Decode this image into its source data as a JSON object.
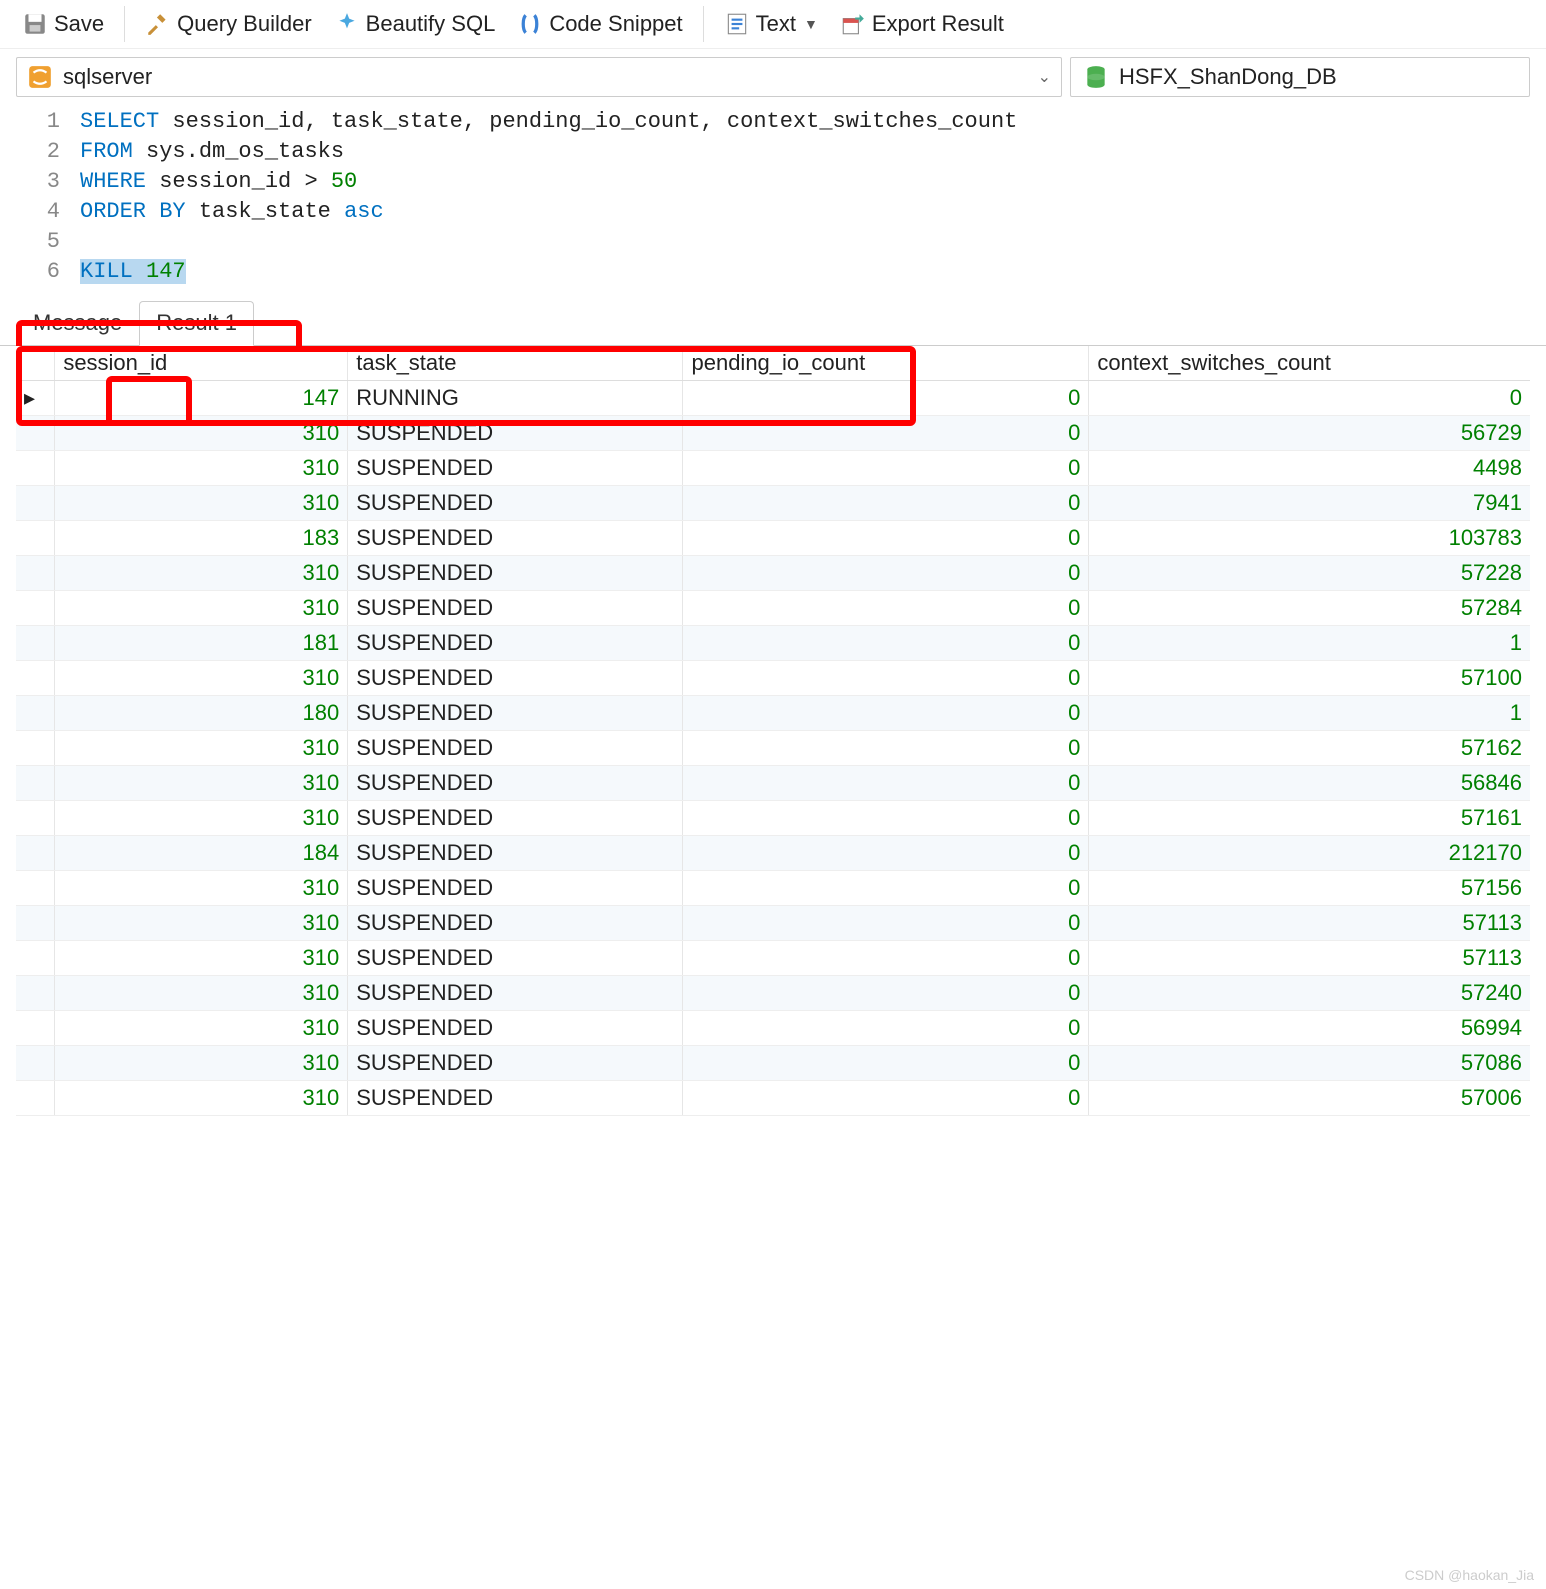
{
  "toolbar": {
    "save": "Save",
    "query_builder": "Query Builder",
    "beautify": "Beautify SQL",
    "code_snippet": "Code Snippet",
    "text": "Text",
    "export_result": "Export Result"
  },
  "connection": {
    "name": "sqlserver",
    "database": "HSFX_ShanDong_DB"
  },
  "editor": {
    "lines": [
      {
        "n": "1",
        "tokens": [
          [
            "kw",
            "SELECT"
          ],
          [
            "",
            " session_id, task_state, pending_io_count, context_switches_count"
          ]
        ]
      },
      {
        "n": "2",
        "tokens": [
          [
            "kw",
            "FROM"
          ],
          [
            "",
            " sys.dm_os_tasks"
          ]
        ]
      },
      {
        "n": "3",
        "tokens": [
          [
            "kw",
            "WHERE"
          ],
          [
            "",
            " session_id > "
          ],
          [
            "num",
            "50"
          ]
        ]
      },
      {
        "n": "4",
        "tokens": [
          [
            "kw",
            "ORDER BY"
          ],
          [
            "",
            " task_state "
          ],
          [
            "kw",
            "asc"
          ]
        ]
      },
      {
        "n": "5",
        "tokens": []
      },
      {
        "n": "6",
        "tokens": [
          [
            "kw sel",
            "KILL"
          ],
          [
            "sel",
            " "
          ],
          [
            "num sel",
            "147"
          ]
        ]
      }
    ]
  },
  "tabs": {
    "message": "Message",
    "result1": "Result 1"
  },
  "grid": {
    "columns": [
      "session_id",
      "task_state",
      "pending_io_count",
      "context_switches_count"
    ],
    "rows": [
      {
        "session_id": "147",
        "task_state": "RUNNING",
        "pending_io_count": "0",
        "context_switches_count": "0"
      },
      {
        "session_id": "310",
        "task_state": "SUSPENDED",
        "pending_io_count": "0",
        "context_switches_count": "56729"
      },
      {
        "session_id": "310",
        "task_state": "SUSPENDED",
        "pending_io_count": "0",
        "context_switches_count": "4498"
      },
      {
        "session_id": "310",
        "task_state": "SUSPENDED",
        "pending_io_count": "0",
        "context_switches_count": "7941"
      },
      {
        "session_id": "183",
        "task_state": "SUSPENDED",
        "pending_io_count": "0",
        "context_switches_count": "103783"
      },
      {
        "session_id": "310",
        "task_state": "SUSPENDED",
        "pending_io_count": "0",
        "context_switches_count": "57228"
      },
      {
        "session_id": "310",
        "task_state": "SUSPENDED",
        "pending_io_count": "0",
        "context_switches_count": "57284"
      },
      {
        "session_id": "181",
        "task_state": "SUSPENDED",
        "pending_io_count": "0",
        "context_switches_count": "1"
      },
      {
        "session_id": "310",
        "task_state": "SUSPENDED",
        "pending_io_count": "0",
        "context_switches_count": "57100"
      },
      {
        "session_id": "180",
        "task_state": "SUSPENDED",
        "pending_io_count": "0",
        "context_switches_count": "1"
      },
      {
        "session_id": "310",
        "task_state": "SUSPENDED",
        "pending_io_count": "0",
        "context_switches_count": "57162"
      },
      {
        "session_id": "310",
        "task_state": "SUSPENDED",
        "pending_io_count": "0",
        "context_switches_count": "56846"
      },
      {
        "session_id": "310",
        "task_state": "SUSPENDED",
        "pending_io_count": "0",
        "context_switches_count": "57161"
      },
      {
        "session_id": "184",
        "task_state": "SUSPENDED",
        "pending_io_count": "0",
        "context_switches_count": "212170"
      },
      {
        "session_id": "310",
        "task_state": "SUSPENDED",
        "pending_io_count": "0",
        "context_switches_count": "57156"
      },
      {
        "session_id": "310",
        "task_state": "SUSPENDED",
        "pending_io_count": "0",
        "context_switches_count": "57113"
      },
      {
        "session_id": "310",
        "task_state": "SUSPENDED",
        "pending_io_count": "0",
        "context_switches_count": "57113"
      },
      {
        "session_id": "310",
        "task_state": "SUSPENDED",
        "pending_io_count": "0",
        "context_switches_count": "57240"
      },
      {
        "session_id": "310",
        "task_state": "SUSPENDED",
        "pending_io_count": "0",
        "context_switches_count": "56994"
      },
      {
        "session_id": "310",
        "task_state": "SUSPENDED",
        "pending_io_count": "0",
        "context_switches_count": "57086"
      },
      {
        "session_id": "310",
        "task_state": "SUSPENDED",
        "pending_io_count": "0",
        "context_switches_count": "57006"
      }
    ]
  },
  "watermark": "CSDN @haokan_Jia"
}
